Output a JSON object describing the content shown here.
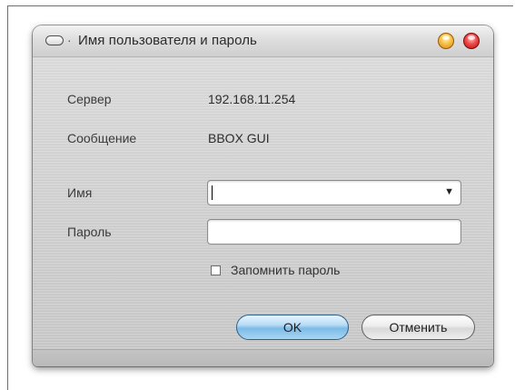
{
  "window": {
    "title": "Имя пользователя и пароль",
    "title_separator": "·"
  },
  "info": {
    "server_label": "Сервер",
    "server_value": "192.168.11.254",
    "message_label": "Сообщение",
    "message_value": "BBOX GUI"
  },
  "form": {
    "name_label": "Имя",
    "name_value": "",
    "name_dropdown_arrow": "▼",
    "password_label": "Пароль",
    "password_value": "",
    "remember_label": "Запомнить пароль",
    "remember_checked": false
  },
  "buttons": {
    "ok_label": "OK",
    "cancel_label": "Отменить"
  },
  "colors": {
    "ok_accent": "#7dbbe6",
    "minimize": "#f7c04a",
    "close": "#ef4a4a"
  }
}
